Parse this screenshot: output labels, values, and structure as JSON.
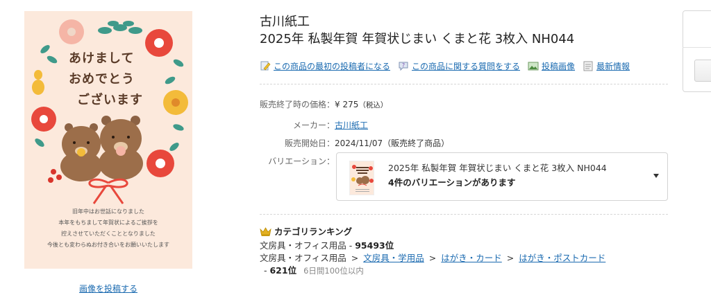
{
  "product_image": {
    "greeting_lines": [
      "あけまして",
      "おめでとう",
      "ございます"
    ],
    "message_lines": [
      "旧年中はお世話になりました",
      "本年をもちまして年賀状によるご挨拶を",
      "控えさせていただくこととなりました",
      "今後とも変わらぬお付き合いをお願いいたします"
    ],
    "post_image_link": "画像を投稿する"
  },
  "header": {
    "maker": "古川紙工",
    "title": "2025年 私製年賀 年賀状じまい くまと花 3枚入 NH044"
  },
  "actions": [
    {
      "label": "この商品の最初の投稿者になる",
      "icon": "pencil-icon"
    },
    {
      "label": "この商品に関する質問をする",
      "icon": "question-icon"
    },
    {
      "label": "投稿画像",
      "icon": "image-icon"
    },
    {
      "label": "最新情報",
      "icon": "news-icon"
    }
  ],
  "details": {
    "price_label": "販売終了時の価格：",
    "price_value": "¥ 275",
    "price_tax": "（税込）",
    "maker_label": "メーカー：",
    "maker_value": "古川紙工",
    "release_label": "販売開始日：",
    "release_value": "2024/11/07（販売終了商品）",
    "variation_label": "バリエーション："
  },
  "variation": {
    "name": "2025年 私製年賀 年賀状じまい くまと花 3枚入 NH044",
    "count": "4件のバリエーションがあります"
  },
  "ranking": {
    "heading": "カテゴリランキング",
    "row1_category": "文房具・オフィス用品",
    "row1_rank": "95493位",
    "row2_root": "文房具・オフィス用品",
    "row2_links": [
      "文房具・学用品",
      "はがき・カード",
      "はがき・ポストカード"
    ],
    "row3_rank": "621位",
    "row3_note": "6日間100位以内"
  },
  "colors": {
    "link": "#1a6ab0",
    "card_bg": "#fce9dc",
    "accent_red": "#e8483c"
  }
}
